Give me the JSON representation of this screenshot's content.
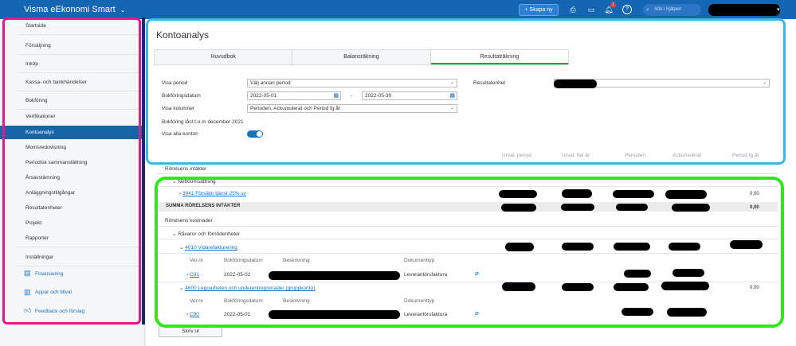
{
  "header": {
    "app_title": "Visma eEkonomi Smart",
    "new_button": "+ Skapa ny",
    "search_placeholder": "Sök i hjälpen",
    "notification_count": "1",
    "brand_color": "#1466b3"
  },
  "sidebar": {
    "items": [
      {
        "label": "Startsida"
      },
      {
        "label": "Försäljning"
      },
      {
        "label": "Inköp"
      },
      {
        "label": "Kassa- och bankhändelser"
      },
      {
        "label": "Bokföring"
      },
      {
        "label": "Verifikationer"
      },
      {
        "label": "Kontoanalys"
      },
      {
        "label": "Momsredovisning"
      },
      {
        "label": "Periodisk sammanställning"
      },
      {
        "label": "Årsavstämning"
      },
      {
        "label": "Anläggningstillgångar"
      },
      {
        "label": "Resultatenheter"
      },
      {
        "label": "Projekt"
      },
      {
        "label": "Rapporter"
      },
      {
        "label": "Inställningar"
      },
      {
        "label": "Finansiering"
      },
      {
        "label": "Appar och tillval"
      },
      {
        "label": "Feedback och förslag"
      }
    ]
  },
  "main": {
    "title": "Kontoanalys",
    "tabs": [
      {
        "label": "Huvudbok"
      },
      {
        "label": "Balansräkning"
      },
      {
        "label": "Resultaträkning"
      }
    ],
    "filters": {
      "period_label": "Visa period",
      "period_value": "Välj annan period",
      "date_label": "Bokföringsdatum",
      "date_from": "2022-05-01",
      "date_sep": "-",
      "date_to": "2022-05-30",
      "columns_label": "Visa kolumner",
      "columns_value": "Perioden, Ackumulerat och Period fg år",
      "locked_text": "Bokföring låst t.o.m december 2021",
      "show_all_label": "Visa alla konton",
      "result_unit_label": "Resultatenhet"
    },
    "column_headers": [
      "Urval, period",
      "Urval, hel år",
      "Perioden",
      "Ackumulerat",
      "Period fg år"
    ],
    "sections": {
      "income_title": "Rörelsens intäkter",
      "income_group": "Nettoomsättning",
      "income_account": "3041 Försäljn tjänst 25% sv",
      "income_account_value": "0,00",
      "income_sum": "SUMMA RÖRELSENS INTÄKTER",
      "income_sum_value": "0,00",
      "cost_title": "Rörelsens kostnader",
      "cost_group": "Råvaror och förnödenheter",
      "account_4010": "4010 Vidarefakturering",
      "sub_headers": [
        "Ver.nr",
        "Bokföringsdatum",
        "Beskrivning",
        "Dokumenttyp"
      ],
      "row1": {
        "ver": "C91",
        "date": "2022-05-02",
        "doctype": "Leverantörsfaktura"
      },
      "account_4600": "4600 Legoarbeten och underentreprenader (gruppkonto)",
      "account_4600_value": "0,00",
      "row2": {
        "ver": "C90",
        "date": "2022-05-01",
        "doctype": "Leverantörsfaktura"
      }
    },
    "print_button": "Skriv ut"
  },
  "annotation_colors": {
    "pink": "#e8168a",
    "cyan": "#3cb8e8",
    "green": "#2ee81a",
    "navy": "#1b2a6b"
  }
}
